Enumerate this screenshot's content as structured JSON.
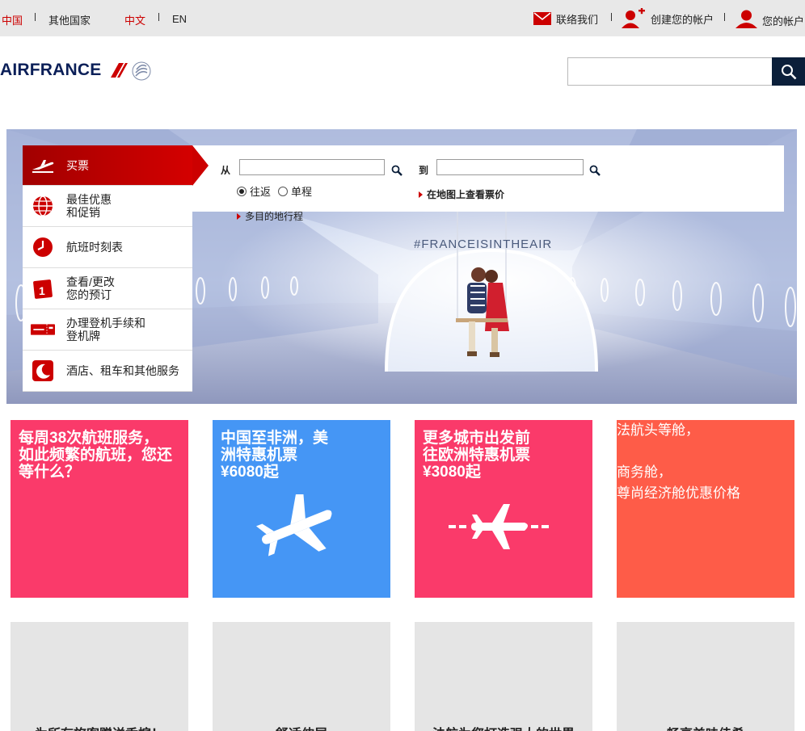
{
  "topbar": {
    "country_china": "中国",
    "country_other": "其他国家",
    "lang_cn": "中文",
    "lang_en": "EN",
    "contact": "联络我们",
    "create_account": "创建您的帐户",
    "my_account": "您的帐户"
  },
  "header": {
    "logo_text": "AIRFRANCE",
    "search_placeholder": ""
  },
  "hero": {
    "hashtag": "#FRANCEISINTHEAIR"
  },
  "booking": {
    "from_label": "从",
    "to_label": "到",
    "round_trip": "往返",
    "one_way": "单程",
    "multi_city": "多目的地行程",
    "map_prices": "在地图上查看票价"
  },
  "menu": {
    "items": [
      {
        "label": "买票",
        "icon": "plane-takeoff-icon"
      },
      {
        "label": "最佳优惠\n和促销",
        "icon": "globe-icon"
      },
      {
        "label": "航班时刻表",
        "icon": "clock-icon"
      },
      {
        "label": "查看/更改\n您的预订",
        "icon": "calendar-icon"
      },
      {
        "label": "办理登机手续和\n登机牌",
        "icon": "boarding-pass-icon"
      },
      {
        "label": "酒店、租车和其他服务",
        "icon": "moon-icon"
      }
    ]
  },
  "tiles": [
    {
      "title": "每周38次航班服务，\n如此频繁的航班，您还\n等什么？",
      "color": "#fa3a6a"
    },
    {
      "title": "中国至非洲，美\n洲特惠机票\n¥6080起",
      "color": "#4596f5",
      "icon": "airplane-icon"
    },
    {
      "title": "更多城市出发前\n往欧洲特惠机票\n¥3080起",
      "color": "#fa3a6a",
      "icon": "airplane-route-icon"
    },
    {
      "title": "法航头等舱，\n\n商务舱，\n尊尚经济舱优惠价格",
      "color": "#fe5c48"
    }
  ],
  "gray_tiles": [
    {
      "text": "为所有旅客赠送香槟！"
    },
    {
      "text": "舒适伸展"
    },
    {
      "text": "法航为您打造强大的世界"
    },
    {
      "text": "畅享美味佳肴"
    }
  ],
  "colors": {
    "brand_red": "#cc0000",
    "brand_navy": "#0b1f58",
    "topbar_bg": "#e8e8e8"
  }
}
